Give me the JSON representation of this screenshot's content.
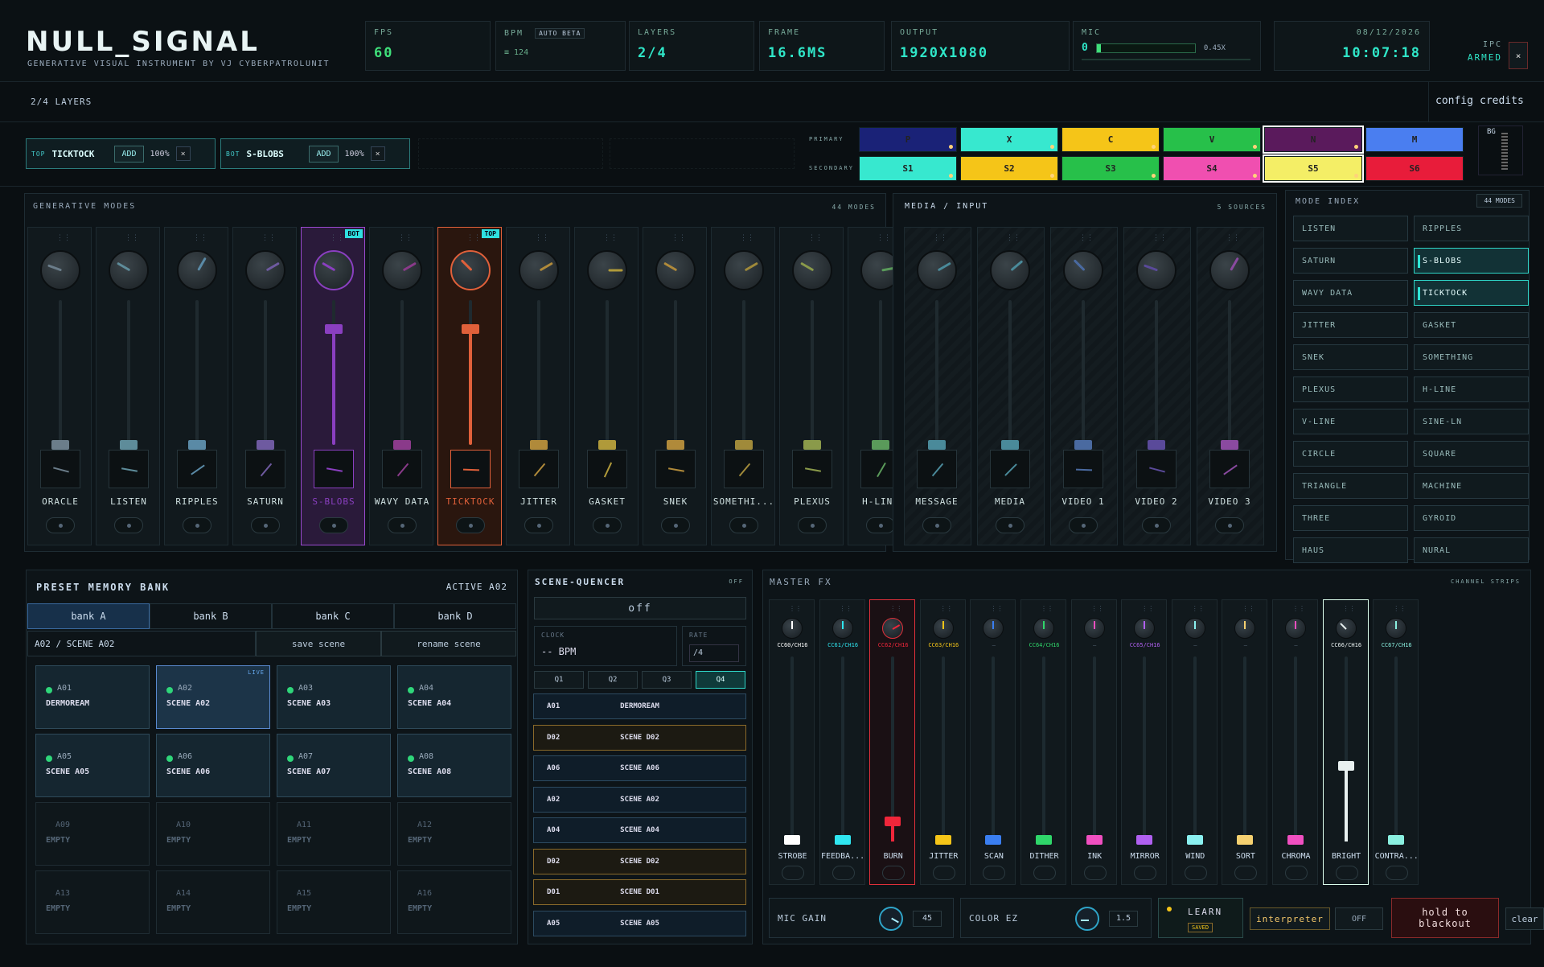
{
  "app": {
    "title": "NULL_SIGNAL",
    "subtitle": "GENERATIVE VISUAL INSTRUMENT BY VJ CYBERPATROLUNIT"
  },
  "stats": {
    "fps": {
      "k": "FPS",
      "v": "60"
    },
    "bpm": {
      "k": "BPM",
      "auto": "AUTO BETA",
      "v": "≡ 124"
    },
    "layers": {
      "k": "LAYERS",
      "v": "2/4"
    },
    "frame": {
      "k": "FRAME",
      "v": "16.6MS"
    },
    "output": {
      "k": "OUTPUT",
      "v": "1920X1080"
    },
    "mic": {
      "k": "MIC",
      "v": "0",
      "gain": "0.45X",
      "level": 0.04
    },
    "date": "08/12/2026",
    "time": "10:07:18",
    "ipc": {
      "k": "IPC",
      "v": "ARMED",
      "close": "×"
    }
  },
  "layersbar": {
    "count": "2/4 LAYERS",
    "config": "config",
    "credits": "credits"
  },
  "slots": [
    {
      "tag": "TOP",
      "name": "TICKTOCK",
      "add": "ADD",
      "pct": "100%",
      "x": "×"
    },
    {
      "tag": "BOT",
      "name": "S-BLOBS",
      "add": "ADD",
      "pct": "100%",
      "x": "×"
    }
  ],
  "palette": {
    "primary_label": "PRIMARY",
    "secondary_label": "SECONDARY",
    "bg_label": "BG",
    "primary": [
      {
        "t": "P",
        "c": "#1a2277"
      },
      {
        "t": "X",
        "c": "#37e8cf"
      },
      {
        "t": "C",
        "c": "#f5c518"
      },
      {
        "t": "V",
        "c": "#27c04a"
      },
      {
        "t": "N",
        "c": "#5a1a5c"
      },
      {
        "t": "M",
        "c": "#4a7ef0"
      }
    ],
    "secondary": [
      {
        "t": "S1",
        "c": "#37e8cf"
      },
      {
        "t": "S2",
        "c": "#f5c518"
      },
      {
        "t": "S3",
        "c": "#27c04a"
      },
      {
        "t": "S4",
        "c": "#f04fb0"
      },
      {
        "t": "S5",
        "c": "#f4ee66"
      },
      {
        "t": "S6",
        "c": "#e81c3a"
      }
    ]
  },
  "gen": {
    "title": "GENERATIVE MODES",
    "count": "44 MODES",
    "strips": [
      {
        "name": "ORACLE",
        "color": "#6b7d8a",
        "level": 0,
        "angle": -70
      },
      {
        "name": "LISTEN",
        "color": "#5e8c9a",
        "level": 0,
        "angle": -60
      },
      {
        "name": "RIPPLES",
        "color": "#5a8aa6",
        "level": 0,
        "angle": 30
      },
      {
        "name": "SATURN",
        "color": "#6e5aa0",
        "level": 0,
        "angle": 60
      },
      {
        "name": "S-BLOBS",
        "color": "#8a3fc0",
        "level": 0.8,
        "angle": -60,
        "badge": "BOT",
        "active": "purple"
      },
      {
        "name": "WAVY DATA",
        "color": "#8a3a8a",
        "level": 0,
        "angle": 60
      },
      {
        "name": "TICKTOCK",
        "color": "#e0603a",
        "level": 0.8,
        "angle": -45,
        "badge": "TOP",
        "active": "orange"
      },
      {
        "name": "JITTER",
        "color": "#b08a3a",
        "level": 0,
        "angle": 60
      },
      {
        "name": "GASKET",
        "color": "#b09a3a",
        "level": 0,
        "angle": 90
      },
      {
        "name": "SNEK",
        "color": "#b08a3a",
        "level": 0,
        "angle": -60
      },
      {
        "name": "SOMETHI...",
        "color": "#a08a3a",
        "level": 0,
        "angle": 60
      },
      {
        "name": "PLEXUS",
        "color": "#8a9a4a",
        "level": 0,
        "angle": -60
      },
      {
        "name": "H-LINE",
        "color": "#5a9a5a",
        "level": 0,
        "angle": 80
      }
    ]
  },
  "media": {
    "title": "MEDIA / INPUT",
    "count": "5 SOURCES",
    "strips": [
      {
        "name": "MESSAGE",
        "color": "#4a8a9a",
        "angle": 60
      },
      {
        "name": "MEDIA",
        "color": "#4a8a9a",
        "angle": 50
      },
      {
        "name": "VIDEO 1",
        "color": "#4a6aa0",
        "angle": -45
      },
      {
        "name": "VIDEO 2",
        "color": "#5a4a9a",
        "angle": -70
      },
      {
        "name": "VIDEO 3",
        "color": "#8a4aa0",
        "angle": 30
      }
    ]
  },
  "modeindex": {
    "title": "MODE INDEX",
    "count": "44 MODES",
    "left": [
      "LISTEN",
      "SATURN",
      "WAVY DATA",
      "JITTER",
      "SNEK",
      "PLEXUS",
      "V-LINE",
      "CIRCLE",
      "TRIANGLE",
      "THREE",
      "HAUS"
    ],
    "right": [
      "RIPPLES",
      "S-BLOBS",
      "TICKTOCK",
      "GASKET",
      "SOMETHING",
      "H-LINE",
      "SINE-LN",
      "SQUARE",
      "MACHINE",
      "GYROID",
      "NURAL"
    ],
    "active": [
      "S-BLOBS",
      "TICKTOCK"
    ]
  },
  "presets": {
    "title": "PRESET MEMORY BANK",
    "active": "ACTIVE A02",
    "banks": [
      "bank A",
      "bank B",
      "bank C",
      "bank D"
    ],
    "scene": "A02 / SCENE A02",
    "save": "save scene",
    "rename": "rename scene",
    "live": "LIVE",
    "items": [
      {
        "id": "A01",
        "n": "DERMOREAM"
      },
      {
        "id": "A02",
        "n": "SCENE A02"
      },
      {
        "id": "A03",
        "n": "SCENE A03"
      },
      {
        "id": "A04",
        "n": "SCENE A04"
      },
      {
        "id": "A05",
        "n": "SCENE A05"
      },
      {
        "id": "A06",
        "n": "SCENE A06"
      },
      {
        "id": "A07",
        "n": "SCENE A07"
      },
      {
        "id": "A08",
        "n": "SCENE A08"
      },
      {
        "id": "A09",
        "n": "EMPTY"
      },
      {
        "id": "A10",
        "n": "EMPTY"
      },
      {
        "id": "A11",
        "n": "EMPTY"
      },
      {
        "id": "A12",
        "n": "EMPTY"
      },
      {
        "id": "A13",
        "n": "EMPTY"
      },
      {
        "id": "A14",
        "n": "EMPTY"
      },
      {
        "id": "A15",
        "n": "EMPTY"
      },
      {
        "id": "A16",
        "n": "EMPTY"
      }
    ]
  },
  "seq": {
    "title": "SCENE-QUENCER",
    "state": "OFF",
    "off": "off",
    "clock_k": "CLOCK",
    "clock_v": "-- BPM",
    "rate_k": "RATE",
    "rate_v": "/4",
    "qs": [
      "Q1",
      "Q2",
      "Q3",
      "Q4"
    ],
    "rows": [
      {
        "a": "A01",
        "b": "DERMOREAM"
      },
      {
        "a": "D02",
        "b": "SCENE D02",
        "gold": true
      },
      {
        "a": "A06",
        "b": "SCENE A06"
      },
      {
        "a": "A02",
        "b": "SCENE A02"
      },
      {
        "a": "A04",
        "b": "SCENE A04"
      },
      {
        "a": "D02",
        "b": "SCENE D02",
        "gold": true
      },
      {
        "a": "D01",
        "b": "SCENE D01",
        "gold": true
      },
      {
        "a": "A05",
        "b": "SCENE A05"
      }
    ]
  },
  "fx": {
    "title": "MASTER FX",
    "sub": "CHANNEL STRIPS",
    "strips": [
      {
        "n": "STROBE",
        "cc": "CC60/CH16",
        "c": "#ffffff",
        "lvl": 0
      },
      {
        "n": "FEEDBA...",
        "cc": "CC61/CH16",
        "c": "#2fe6f0",
        "lvl": 0
      },
      {
        "n": "BURN",
        "cc": "CC62/CH16",
        "c": "#f0263a",
        "lvl": 0.1
      },
      {
        "n": "JITTER",
        "cc": "CC63/CH16",
        "c": "#f5c518",
        "lvl": 0
      },
      {
        "n": "SCAN",
        "cc": "—",
        "c": "#3a7ef0",
        "lvl": 0
      },
      {
        "n": "DITHER",
        "cc": "CC64/CH16",
        "c": "#2fd66a",
        "lvl": 0
      },
      {
        "n": "INK",
        "cc": "—",
        "c": "#f04fc0",
        "lvl": 0
      },
      {
        "n": "MIRROR",
        "cc": "CC65/CH16",
        "c": "#b060f0",
        "lvl": 0
      },
      {
        "n": "WIND",
        "cc": "—",
        "c": "#8af0f0",
        "lvl": 0
      },
      {
        "n": "SORT",
        "cc": "—",
        "c": "#f5d070",
        "lvl": 0
      },
      {
        "n": "CHROMA",
        "cc": "—",
        "c": "#f04fc0",
        "lvl": 0
      },
      {
        "n": "BRIGHT",
        "cc": "CC66/CH16",
        "c": "#e8f0f0",
        "lvl": 0.4
      },
      {
        "n": "CONTRA...",
        "cc": "CC67/CH16",
        "c": "#8af0e0",
        "lvl": 0
      }
    ]
  },
  "bottom": {
    "mic_gain": "MIC GAIN",
    "mic_val": "45",
    "color_ez": "COLOR EZ",
    "color_val": "1.5",
    "learn": "LEARN",
    "saved": "SAVED",
    "interp": "interpreter",
    "off": "OFF",
    "blackout": "hold to blackout",
    "clear": "clear"
  }
}
